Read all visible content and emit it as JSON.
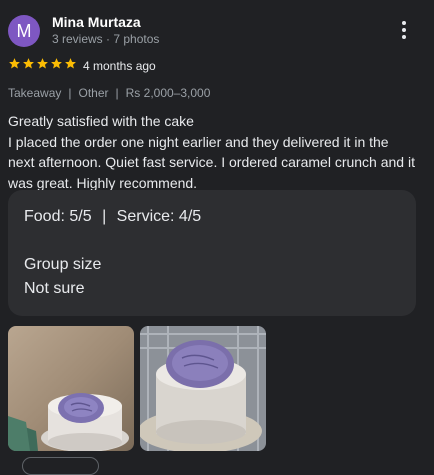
{
  "reviewer": {
    "avatar_letter": "M",
    "avatar_color": "#7e57c2",
    "name": "Mina Murtaza",
    "stats": "3 reviews · 7 photos"
  },
  "rating": {
    "stars": 5,
    "max_stars": 5,
    "star_color": "#fbbc04",
    "time": "4 months ago"
  },
  "attributes": [
    "Takeaway",
    "Other",
    "Rs 2,000–3,000"
  ],
  "review_text": [
    "Greatly satisfied with the cake",
    "I placed the order one night earlier and they delivered it in the next afternoon. Quiet fast service. I ordered caramel crunch and it was great. Highly recommend."
  ],
  "details": {
    "food": "Food: 5/5",
    "divider": "|",
    "service": "Service: 4/5",
    "group_label": "Group size",
    "group_value": "Not sure"
  },
  "photos": [
    {
      "name": "cake-photo-1"
    },
    {
      "name": "cake-photo-2"
    }
  ]
}
